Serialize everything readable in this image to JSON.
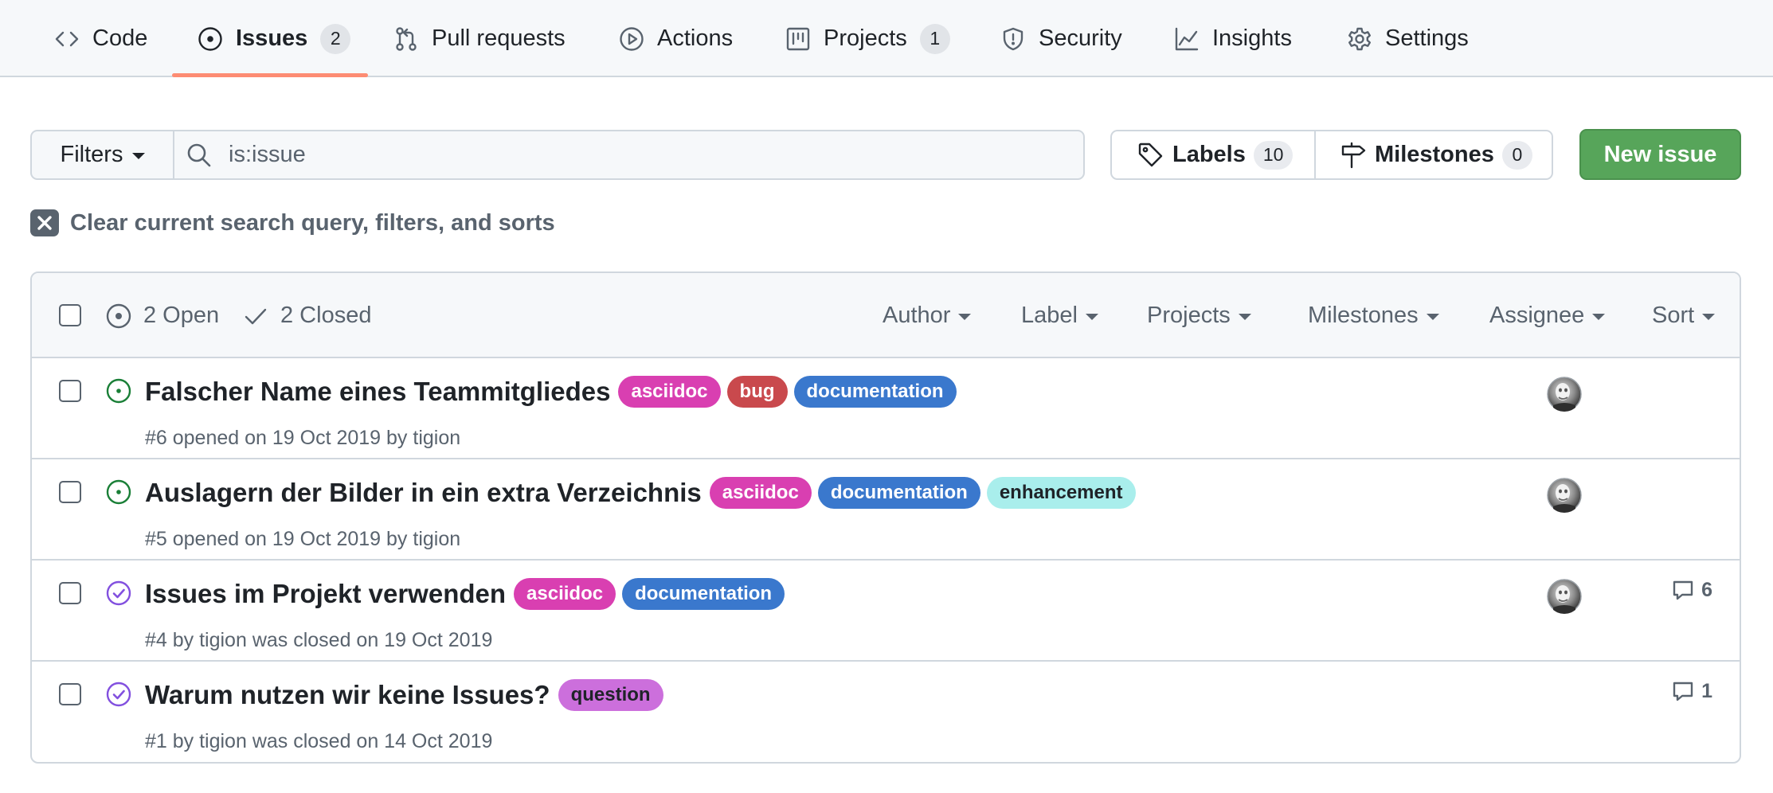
{
  "nav": {
    "tabs": [
      {
        "label": "Code",
        "icon": "code-icon"
      },
      {
        "label": "Issues",
        "icon": "issue-opened-icon",
        "count": "2"
      },
      {
        "label": "Pull requests",
        "icon": "git-pull-request-icon"
      },
      {
        "label": "Actions",
        "icon": "play-icon"
      },
      {
        "label": "Projects",
        "icon": "project-icon",
        "count": "1"
      },
      {
        "label": "Security",
        "icon": "shield-icon"
      },
      {
        "label": "Insights",
        "icon": "graph-icon"
      },
      {
        "label": "Settings",
        "icon": "gear-icon"
      }
    ],
    "active_tab": "Issues",
    "active_underline_color": "#fd8c73"
  },
  "filter_bar": {
    "filters_label": "Filters",
    "search_value": "is:issue",
    "labels_label": "Labels",
    "labels_count": "10",
    "milestones_label": "Milestones",
    "milestones_count": "0",
    "new_issue_label": "New issue",
    "new_issue_color": "#57a55a",
    "clear_text": "Clear current search query, filters, and sorts"
  },
  "list_header": {
    "open_label": "2 Open",
    "closed_label": "2 Closed",
    "dropdowns": [
      "Author",
      "Label",
      "Projects",
      "Milestones",
      "Assignee",
      "Sort"
    ]
  },
  "issues": [
    {
      "state": "open",
      "title": "Falscher Name eines Teammitgliedes",
      "labels": [
        {
          "name": "asciidoc",
          "bg": "#d93fb1",
          "fg": "#ffffff"
        },
        {
          "name": "bug",
          "bg": "#c9494d",
          "fg": "#ffffff"
        },
        {
          "name": "documentation",
          "bg": "#3a78cd",
          "fg": "#ffffff"
        }
      ],
      "meta": "#6 opened on 19 Oct 2019 by tigion",
      "has_assignee": true,
      "comments": ""
    },
    {
      "state": "open",
      "title": "Auslagern der Bilder in ein extra Verzeichnis",
      "labels": [
        {
          "name": "asciidoc",
          "bg": "#d93fb1",
          "fg": "#ffffff"
        },
        {
          "name": "documentation",
          "bg": "#3a78cd",
          "fg": "#ffffff"
        },
        {
          "name": "enhancement",
          "bg": "#a9eeec",
          "fg": "#1f2328"
        }
      ],
      "meta": "#5 opened on 19 Oct 2019 by tigion",
      "has_assignee": true,
      "comments": ""
    },
    {
      "state": "closed",
      "title": "Issues im Projekt verwenden",
      "labels": [
        {
          "name": "asciidoc",
          "bg": "#d93fb1",
          "fg": "#ffffff"
        },
        {
          "name": "documentation",
          "bg": "#3a78cd",
          "fg": "#ffffff"
        }
      ],
      "meta": "#4 by tigion was closed on 19 Oct 2019",
      "has_assignee": true,
      "comments": "6"
    },
    {
      "state": "closed",
      "title": "Warum nutzen wir keine Issues?",
      "labels": [
        {
          "name": "question",
          "bg": "#cc6fdc",
          "fg": "#1f2328"
        }
      ],
      "meta": "#1 by tigion was closed on 14 Oct 2019",
      "has_assignee": false,
      "comments": "1"
    }
  ],
  "colors": {
    "open_state": "#1a7f37",
    "closed_state": "#8250df",
    "muted_text": "#59636e",
    "border": "#d0d7de"
  }
}
